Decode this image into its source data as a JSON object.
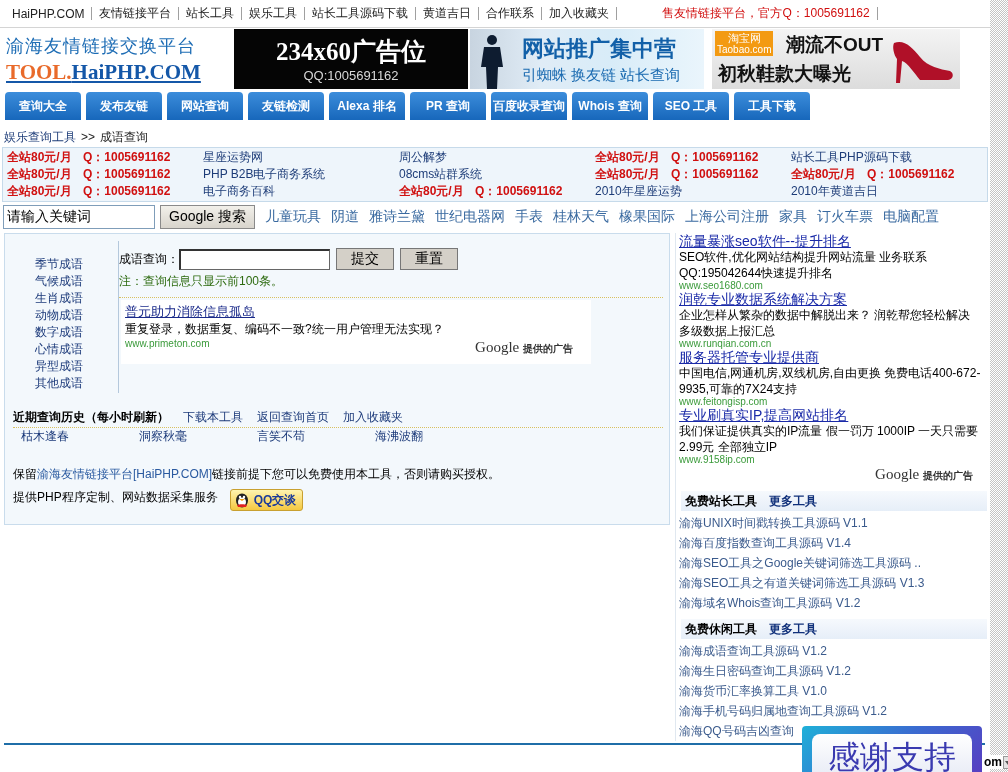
{
  "top_nav": {
    "links": [
      "HaiPHP.COM",
      "友情链接平台",
      "站长工具",
      "娱乐工具",
      "站长工具源码下载",
      "黄道吉日",
      "合作联系",
      "加入收藏夹"
    ],
    "promo": "售友情链接平台，官方Q：1005691162"
  },
  "header": {
    "logo": {
      "title": "渝海友情链接交换平台",
      "domain_prefix": "TOOL.",
      "domain": "HaiPHP.COM"
    },
    "banners": [
      {
        "kind": "placeholder",
        "title": "234x60广告位",
        "subtitle": "QQ:1005691162"
      },
      {
        "kind": "promo",
        "title": "网站推广集中营",
        "subtitle": "引蜘蛛 换友链 站长查询"
      },
      {
        "kind": "shop",
        "badge": "淘宝网",
        "badge_sub": "Taobao.com",
        "title": "潮流不OUT",
        "subtitle": "初秋鞋款大曝光"
      }
    ]
  },
  "tabs": [
    "查询大全",
    "发布友链",
    "网站查询",
    "友链检测",
    "Alexa 排名",
    "PR 查询",
    "百度收录查询",
    "Whois 查询",
    "SEO 工具",
    "工具下载"
  ],
  "breadcrumb": {
    "parent": "娱乐查询工具",
    "separator": ">>",
    "current": "成语查询"
  },
  "ad_links": [
    [
      {
        "kind": "promo",
        "text": "全站80元/月 Q：1005691162"
      },
      {
        "kind": "link",
        "text": "星座运势网"
      },
      {
        "kind": "link",
        "text": "周公解梦"
      },
      {
        "kind": "promo",
        "text": "全站80元/月 Q：1005691162"
      },
      {
        "kind": "link",
        "text": "站长工具PHP源码下载"
      }
    ],
    [
      {
        "kind": "promo",
        "text": "全站80元/月 Q：1005691162"
      },
      {
        "kind": "link",
        "text": "PHP B2B电子商务系统"
      },
      {
        "kind": "link",
        "text": "08cms站群系统"
      },
      {
        "kind": "promo",
        "text": "全站80元/月 Q：1005691162"
      },
      {
        "kind": "promo",
        "text": "全站80元/月 Q：1005691162"
      }
    ],
    [
      {
        "kind": "promo",
        "text": "全站80元/月 Q：1005691162"
      },
      {
        "kind": "link",
        "text": "电子商务百科"
      },
      {
        "kind": "promo",
        "text": "全站80元/月 Q：1005691162"
      },
      {
        "kind": "link",
        "text": "2010年星座运势"
      },
      {
        "kind": "link",
        "text": "2010年黄道吉日"
      }
    ]
  ],
  "search": {
    "value": "请输入关键词",
    "button": "Google 搜索",
    "keywords": [
      "儿童玩具",
      "阴道",
      "雅诗兰黛",
      "世纪电器网",
      "手表",
      "桂林天气",
      "橡果国际",
      "上海公司注册",
      "家具",
      "订火车票",
      "电脑配置"
    ]
  },
  "idiom_categories": [
    "季节成语",
    "气候成语",
    "生肖成语",
    "动物成语",
    "数字成语",
    "心情成语",
    "异型成语",
    "其他成语"
  ],
  "query_form": {
    "label": "成语查询：",
    "submit": "提交",
    "reset": "重置",
    "note": "注：查询信息只显示前100条。"
  },
  "inline_ad": {
    "title": "普元助力消除信息孤岛",
    "text": "重复登录，数据重复、编码不一致?统一用户管理无法实现？",
    "url": "www.primeton.com",
    "brand": "Google",
    "label": "提供的广告"
  },
  "history": {
    "title": "近期查询历史（每小时刷新）",
    "links": [
      "下载本工具",
      "返回查询首页",
      "加入收藏夹"
    ],
    "items": [
      "枯木逢春",
      "洞察秋毫",
      "言笑不苟",
      "海沸波翻"
    ]
  },
  "footer": {
    "notice_before": "保留",
    "notice_link": "渝海友情链接平台[HaiPHP.COM]",
    "notice_after": "链接前提下您可以免费使用本工具，否则请购买授权。",
    "services": "提供PHP程序定制、网站数据采集服务",
    "qq_button": "QQ交谈"
  },
  "sidebar_ads": {
    "ads": [
      {
        "title": "流量暴涨seo软件--提升排名",
        "text": "SEO软件,优化网站结构提升网站流量 业务联系QQ:195042644快速提升排名",
        "url": "www.seo1680.com"
      },
      {
        "title": "润乾专业数据系统解决方案",
        "text": "企业怎样从繁杂的数据中解脱出来？ 润乾帮您轻松解决多级数据上报汇总",
        "url": "www.runqian.com.cn"
      },
      {
        "title": "服务器托管专业提供商",
        "text": "中国电信,网通机房,双线机房,自由更换 免费电话400-672-9935,可靠的7X24支持",
        "url": "www.feitongisp.com"
      },
      {
        "title": "专业刷真实IP,提高网站排名",
        "text": "我们保证提供真实的IP流量 假一罚万 1000IP 一天只需要2.99元 全部独立IP",
        "url": "www.9158ip.com"
      }
    ],
    "brand": "Google",
    "label": "提供的广告"
  },
  "tool_sections": [
    {
      "title": "免费站长工具",
      "more": "更多工具",
      "items": [
        "渝海UNIX时间戳转换工具源码 V1.1",
        "渝海百度指数查询工具源码 V1.4",
        "渝海SEO工具之Google关键词筛选工具源码 ..",
        "渝海SEO工具之有道关键词筛选工具源码 V1.3",
        "渝海域名Whois查询工具源码 V1.2"
      ]
    },
    {
      "title": "免费休闲工具",
      "more": "更多工具",
      "items": [
        "渝海成语查询工具源码 V1.2",
        "渝海生日密码查询工具源码 V1.2",
        "渝海货币汇率换算工具 V1.0",
        "渝海手机号码归属地查询工具源码 V1.2",
        "渝海QQ号码吉凶查询"
      ]
    }
  ],
  "popup": {
    "text": "感谢支持"
  },
  "corner_widget": {
    "text": "om"
  }
}
